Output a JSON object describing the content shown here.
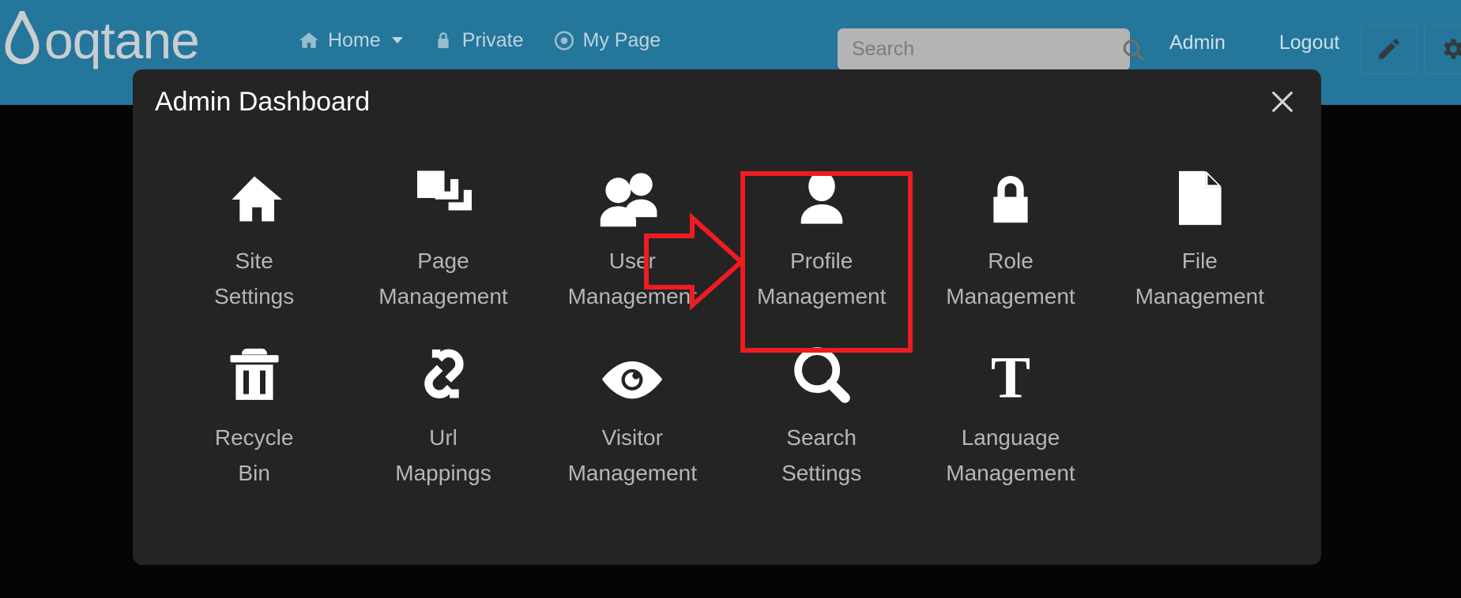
{
  "topbar": {
    "brand": "oqtane",
    "brand_icon": "water-drop-logo",
    "nav": [
      {
        "label": "Home",
        "icon": "home-icon",
        "has_caret": true
      },
      {
        "label": "Private",
        "icon": "lock-icon",
        "has_caret": false
      },
      {
        "label": "My Page",
        "icon": "target-icon",
        "has_caret": false
      }
    ],
    "search": {
      "placeholder": "Search",
      "value": "",
      "icon": "search-icon"
    },
    "links": [
      {
        "label": "Admin"
      },
      {
        "label": "Logout"
      }
    ],
    "buttons": [
      {
        "name": "edit-button",
        "icon": "pencil-icon"
      },
      {
        "name": "settings-button",
        "icon": "gear-icon"
      }
    ],
    "bg_color": "#24769b"
  },
  "modal": {
    "title": "Admin Dashboard",
    "close_icon": "close-icon",
    "bg_color": "#242424",
    "tiles": [
      {
        "label": "Site\nSettings",
        "line1": "Site",
        "line2": "Settings",
        "icon": "home-icon"
      },
      {
        "label": "Page\nManagement",
        "line1": "Page",
        "line2": "Management",
        "icon": "pages-stack-icon"
      },
      {
        "label": "User\nManagement",
        "line1": "User",
        "line2": "Management",
        "icon": "users-group-icon"
      },
      {
        "label": "Profile\nManagement",
        "line1": "Profile",
        "line2": "Management",
        "icon": "user-person-icon"
      },
      {
        "label": "Role\nManagement",
        "line1": "Role",
        "line2": "Management",
        "icon": "lock-icon"
      },
      {
        "label": "File\nManagement",
        "line1": "File",
        "line2": "Management",
        "icon": "file-document-icon"
      },
      {
        "label": "Recycle\nBin",
        "line1": "Recycle",
        "line2": "Bin",
        "icon": "trash-bin-icon"
      },
      {
        "label": "Url\nMappings",
        "line1": "Url",
        "line2": "Mappings",
        "icon": "broken-link-icon"
      },
      {
        "label": "Visitor\nManagement",
        "line1": "Visitor",
        "line2": "Management",
        "icon": "eye-icon"
      },
      {
        "label": "Search\nSettings",
        "line1": "Search",
        "line2": "Settings",
        "icon": "magnifier-icon"
      },
      {
        "label": "Language\nManagement",
        "line1": "Language",
        "line2": "Management",
        "icon": "text-t-icon"
      }
    ]
  },
  "annotation": {
    "color": "#ee1c22",
    "highlight_target": "Profile Management",
    "arrow_icon": "right-arrow-annotation",
    "box_icon": "highlight-rectangle-annotation"
  }
}
